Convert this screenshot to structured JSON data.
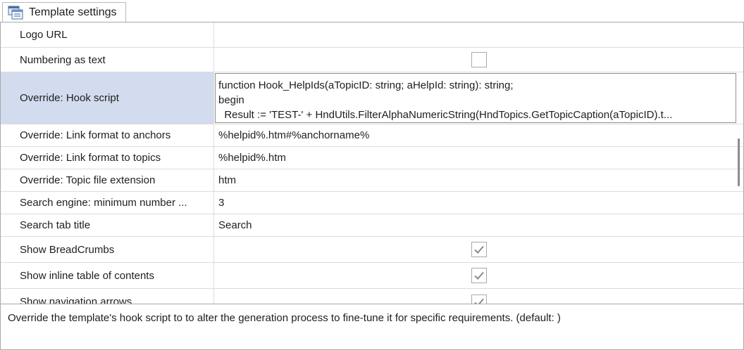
{
  "tab": {
    "label": "Template settings",
    "icon": "settings-list-icon"
  },
  "rows": [
    {
      "name": "Logo URL",
      "type": "text",
      "value": ""
    },
    {
      "name": "Numbering as text",
      "type": "checkbox",
      "checked": false
    },
    {
      "name": "Override: Hook script",
      "type": "code",
      "selected": true,
      "lines": [
        "function Hook_HelpIds(aTopicID: string; aHelpId: string): string;",
        "begin",
        "  Result := 'TEST-' + HndUtils.FilterAlphaNumericString(HndTopics.GetTopicCaption(aTopicID).t..."
      ]
    },
    {
      "name": "Override: Link format to anchors",
      "type": "text",
      "value": "%helpid%.htm#%anchorname%"
    },
    {
      "name": "Override: Link format to topics",
      "type": "text",
      "value": "%helpid%.htm"
    },
    {
      "name": "Override: Topic file extension",
      "type": "text",
      "value": "htm"
    },
    {
      "name": "Search engine: minimum number ...",
      "type": "text",
      "value": "3"
    },
    {
      "name": "Search tab title",
      "type": "text",
      "value": "Search"
    },
    {
      "name": "Show BreadCrumbs",
      "type": "checkbox",
      "checked": true
    },
    {
      "name": "Show inline table of contents",
      "type": "checkbox",
      "checked": true
    },
    {
      "name": "Show navigation arrows",
      "type": "checkbox",
      "checked": true
    }
  ],
  "description": "Override the template's hook script to to alter the generation process to fine-tune it for specific requirements. (default: )",
  "colors": {
    "selected_row": "#d2dcee",
    "grid_line": "#dcdcdc",
    "border": "#a9a9a9",
    "check": "#8a8a8a"
  }
}
